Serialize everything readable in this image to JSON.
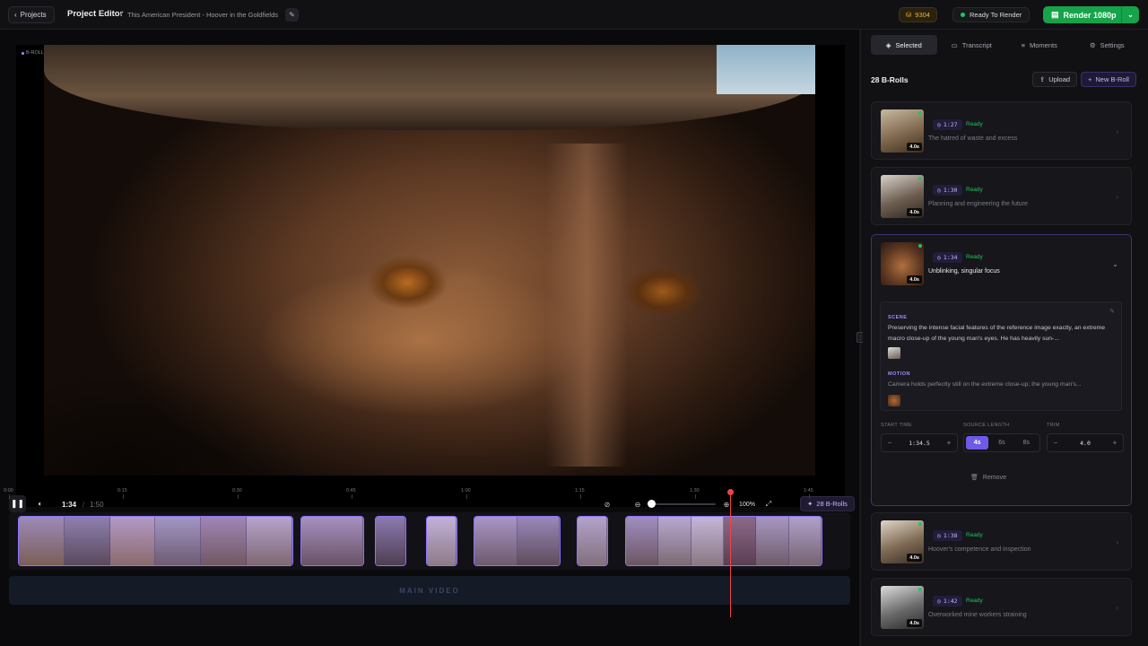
{
  "topbar": {
    "back_label": "Projects",
    "project_label": "Project Editor",
    "separator": "/",
    "doc_title": "This American President - Hoover in the Goldfields",
    "credits": "9304",
    "status": "Ready To Render",
    "render_label": "Render 1080p"
  },
  "video": {
    "tag_label": "B-ROLL"
  },
  "player": {
    "current_time": "1:34",
    "time_separator": "/",
    "total_time": "1:50",
    "zoom": "100%",
    "broll_button": "28 B-Rolls"
  },
  "timeline": {
    "ticks": [
      "0:00",
      "0:15",
      "0:30",
      "0:45",
      "1:00",
      "1:15",
      "1:30",
      "1:45"
    ],
    "main_label": "MAIN VIDEO"
  },
  "panel": {
    "tabs": [
      {
        "label": "Selected",
        "icon": "layers-icon"
      },
      {
        "label": "Transcript",
        "icon": "document-icon"
      },
      {
        "label": "Moments",
        "icon": "list-icon"
      },
      {
        "label": "Settings",
        "icon": "sliders-icon"
      }
    ],
    "title": "28 B-Rolls",
    "upload_label": "Upload",
    "new_label": "New B-Roll",
    "items": [
      {
        "time": "1:27",
        "status": "Ready",
        "duration": "4.0s",
        "desc": "The hatred of waste and excess"
      },
      {
        "time": "1:30",
        "status": "Ready",
        "duration": "4.0s",
        "desc": "Planning and engineering the future"
      },
      {
        "time": "1:34",
        "status": "Ready",
        "duration": "4.0s",
        "desc": "Unblinking, singular focus"
      },
      {
        "time": "1:38",
        "status": "Ready",
        "duration": "4.0s",
        "desc": "Hoover's competence and inspection"
      },
      {
        "time": "1:42",
        "status": "Ready",
        "duration": "4.0s",
        "desc": "Overworked mine workers straining"
      }
    ],
    "expanded": {
      "scene_label": "SCENE",
      "scene_text": "Preserving the intense facial features of the reference image exactly, an extreme macro close-up of the young man's eyes. He has heavily sun-...",
      "motion_label": "MOTION",
      "motion_text": "Camera holds perfectly still on the extreme close-up; the young man's...",
      "start_time_label": "START TIME",
      "start_time_value": "1:34.5",
      "source_length_label": "SOURCE LENGTH",
      "source_options": [
        "4s",
        "6s",
        "8s"
      ],
      "source_selected": "4s",
      "trim_label": "TRIM",
      "trim_value": "4.0",
      "remove_label": "Remove"
    }
  },
  "colors": {
    "accent": "#8b74ff",
    "render_green": "#16a34a",
    "ready_green": "#22c55e",
    "playhead_red": "#ef4444",
    "credits_gold": "#f0b23a"
  }
}
